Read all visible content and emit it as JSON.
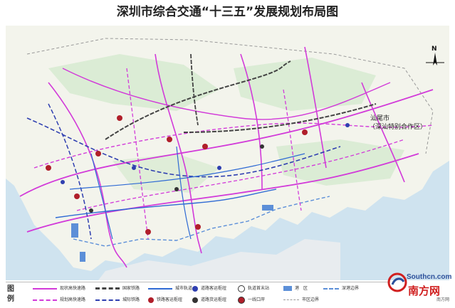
{
  "map": {
    "title": "深圳市综合交通“十三五”发展规划布局图",
    "region_label_line1": "汕尾市",
    "region_label_line2": "（深汕特别合作区）",
    "compass_label": "N",
    "colors": {
      "land": "#f3f4ec",
      "land_green": "#d5ead0",
      "sea": "#cfe3ef",
      "high_speed_rail": "#d23ad9",
      "national_rail": "#7a7a7a",
      "intercity_rail": "#2f3fb0",
      "metro": "#2f6ad4",
      "border": "#5c8fd8",
      "road_hub": "#b01e2a"
    }
  },
  "legend": {
    "title": "图 例",
    "items": [
      {
        "label": "现状高快速路",
        "kind": "line",
        "color": "#d23ad9",
        "style": "solid"
      },
      {
        "label": "规划高快速路",
        "kind": "line",
        "color": "#d23ad9",
        "style": "dashed"
      },
      {
        "label": "国家铁路",
        "kind": "line",
        "color": "#444444",
        "style": "rail"
      },
      {
        "label": "城际铁路",
        "kind": "line",
        "color": "#2f3fb0",
        "style": "dashed"
      },
      {
        "label": "城市轨道",
        "kind": "line",
        "color": "#2f6ad4",
        "style": "solid"
      },
      {
        "label": "道路客运枢纽",
        "kind": "dot",
        "color": "#2f3fb0"
      },
      {
        "label": "道路货运枢纽",
        "kind": "dot",
        "color": "#333333"
      },
      {
        "label": "铁路客运枢纽",
        "kind": "dot",
        "color": "#b01e2a"
      },
      {
        "label": "轨道首末站",
        "kind": "dot",
        "color": "#ffffff"
      },
      {
        "label": "一线口岸",
        "kind": "dot",
        "color": "#b01e2a"
      },
      {
        "label": "港　区",
        "kind": "box",
        "color": "#5c8fd8"
      },
      {
        "label": "市区边界",
        "kind": "line",
        "color": "#999999",
        "style": "dashed"
      },
      {
        "label": "深港边界",
        "kind": "line",
        "color": "#5c8fd8",
        "style": "dashed"
      }
    ]
  },
  "watermark": {
    "site": "Southcn.com",
    "cn_name": "南方网",
    "sub": "南方网"
  }
}
